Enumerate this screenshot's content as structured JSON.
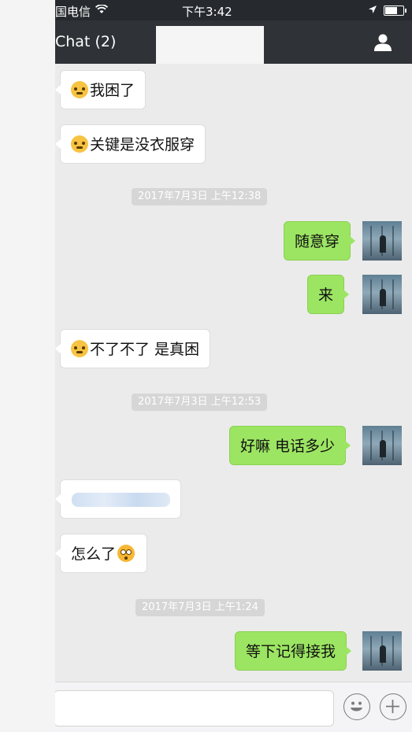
{
  "statusbar": {
    "carrier": "国电信",
    "time": "下午3:42"
  },
  "nav": {
    "title": "Chat (2)"
  },
  "messages": [
    {
      "side": "in",
      "text": "我困了",
      "emoji": true
    },
    {
      "side": "in",
      "text": "关键是没衣服穿",
      "emoji": true
    },
    {
      "side": "ts",
      "text": "2017年7月3日 上午12:38"
    },
    {
      "side": "out",
      "text": "随意穿"
    },
    {
      "side": "out",
      "text": "来"
    },
    {
      "side": "in",
      "text": "不了不了 是真困",
      "emoji": true
    },
    {
      "side": "ts",
      "text": "2017年7月3日 上午12:53"
    },
    {
      "side": "out",
      "text": "好嘛 电话多少"
    },
    {
      "side": "in",
      "text": ""
    },
    {
      "side": "in",
      "text": "怎么了"
    },
    {
      "side": "ts",
      "text": "2017年7月3日 上午1:24"
    },
    {
      "side": "out",
      "text": "等下记得接我"
    }
  ],
  "colors": {
    "outgoing_bubble": "#9ce563",
    "incoming_bubble": "#ffffff",
    "nav_bg": "#2f3337"
  },
  "icons": [
    "wifi-icon",
    "location-arrow-icon",
    "battery-icon",
    "contact-profile-icon",
    "emoji-icon",
    "plus-icon",
    "flushed-emoji-icon",
    "tears-of-joy-emoji-icon"
  ]
}
